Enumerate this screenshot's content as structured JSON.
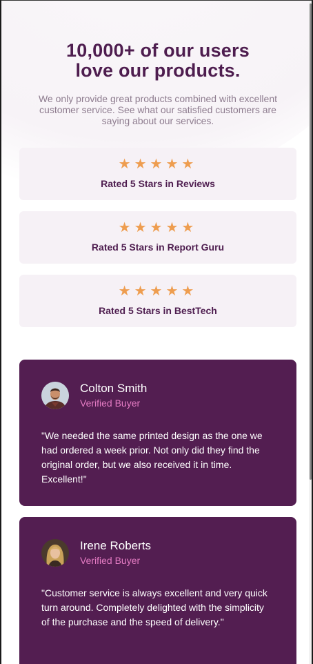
{
  "header": {
    "title_line1": "10,000+ of our users",
    "title_line2": "love our products.",
    "subtitle": "We only provide great products combined with excellent customer service. See what our satisfied customers are saying about our services."
  },
  "ratings": [
    {
      "stars": 5,
      "label": "Rated 5 Stars in Reviews"
    },
    {
      "stars": 5,
      "label": "Rated 5 Stars in Report Guru"
    },
    {
      "stars": 5,
      "label": "Rated 5 Stars in BestTech"
    }
  ],
  "testimonials": [
    {
      "name": "Colton Smith",
      "badge": "Verified Buyer",
      "quote": "\"We needed the same printed design as the one we had ordered a week prior. Not only did they find the original order, but we also received it in time. Excellent!\""
    },
    {
      "name": "Irene Roberts",
      "badge": "Verified Buyer",
      "quote": "\"Customer service is always excellent and very quick turn around. Completely delighted with the simplicity of the purchase and the speed of delivery.\""
    }
  ],
  "colors": {
    "heading": "#4e1d4f",
    "subtitle": "#8e7c8f",
    "star": "#ee9d4f",
    "rating_bg": "#f6f1f6",
    "card_bg": "#531e51",
    "badge": "#e57cc4"
  },
  "icons": {
    "star": "star-icon",
    "avatar_colton": "avatar-colton-smith",
    "avatar_irene": "avatar-irene-roberts"
  }
}
